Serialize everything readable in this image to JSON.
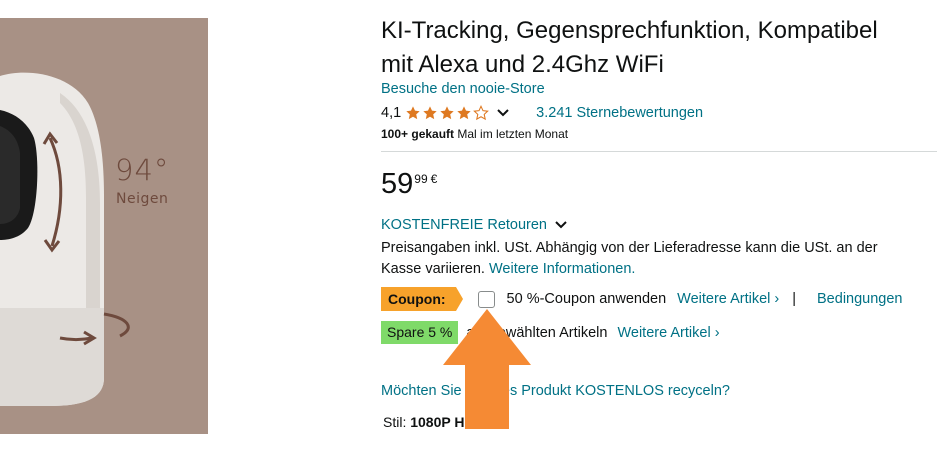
{
  "image": {
    "tilt_value": "94°",
    "tilt_label": "Neigen",
    "background_color": "#a89185"
  },
  "product": {
    "title_line1": "KI-Tracking, Gegensprechfunktion, Kompatibel",
    "title_line2": "mit Alexa und 2.4Ghz WiFi",
    "store_link": "Besuche den nooie-Store",
    "rating_value": "4,1",
    "rating_stars": 4.1,
    "ratings_count": "3.241 Sternebewertungen",
    "bought_bold": "100+ gekauft",
    "bought_rest": " Mal im letzten Monat"
  },
  "price": {
    "whole": "59",
    "fraction": "99",
    "currency": "€"
  },
  "returns": {
    "label": "KOSTENFREIE Retouren"
  },
  "tax": {
    "text": "Preisangaben inkl. USt. Abhängig von der Lieferadresse kann die USt. an der Kasse variieren. ",
    "more_link": "Weitere Informationen."
  },
  "coupon": {
    "badge": "Coupon:",
    "text": "50 %-Coupon anwenden",
    "more_link": "Weitere Artikel ›",
    "separator": "|",
    "conditions_link": "Bedingungen",
    "checked": false
  },
  "savings": {
    "badge": "Spare 5 %",
    "text": "ausgewählten Artikeln",
    "more_link": "Weitere Artikel ›"
  },
  "recycle": {
    "link": "Möchten Sie Ihr altes Produkt KOSTENLOS recyceln?"
  },
  "style": {
    "label": "Stil: ",
    "value": "1080P HD"
  },
  "colors": {
    "accent_orange": "#f7a22b",
    "save_green": "#7fda69",
    "link": "#007185",
    "star": "#de7921",
    "arrow": "#f58a34"
  }
}
